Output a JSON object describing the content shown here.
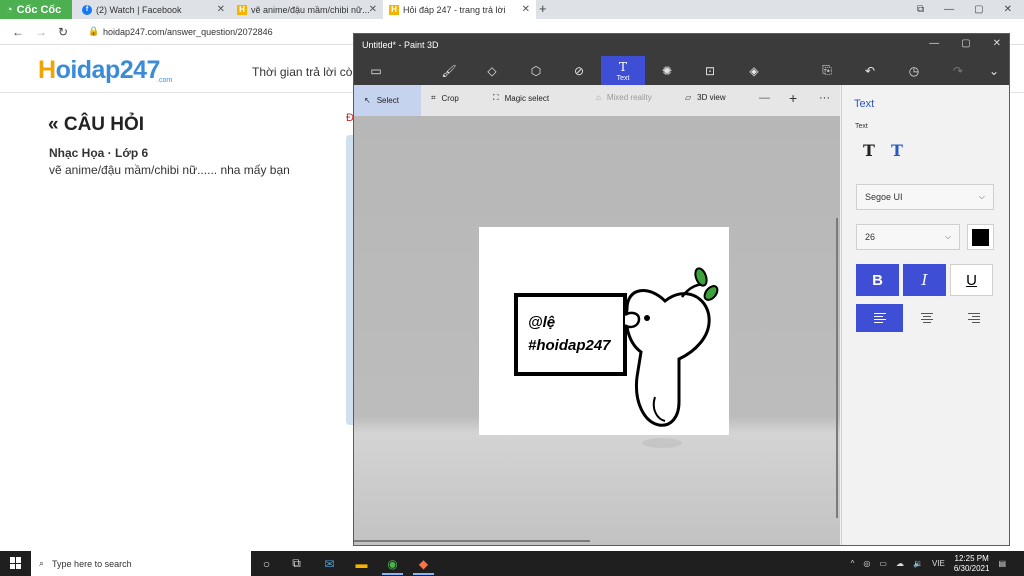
{
  "browser": {
    "brand_label": "Cốc Cốc",
    "tabs": [
      {
        "label": "(2) Watch | Facebook",
        "icon": "facebook-icon"
      },
      {
        "label": "vẽ anime/đậu mầm/chibi nữ...",
        "icon": "hoidap-icon"
      },
      {
        "label": "Hỏi đáp 247 - trang trả lời",
        "icon": "hoidap-icon"
      }
    ],
    "new_tab": "+",
    "url": "hoidap247.com/answer_question/2072846"
  },
  "site": {
    "logo_main": "oidap247",
    "logo_h": "H",
    "logo_sub": ".com",
    "header_text": "Thời gian trả lời cò",
    "question_heading": "CÂU HỎI",
    "question_meta": "Nhạc Họa · Lớp 6",
    "question_body": "vẽ anime/đậu mầm/chibi nữ...... nha mấy bạn",
    "red_mark": "Đ"
  },
  "paint3d": {
    "title": "Untitled* - Paint 3D",
    "toolbar": [
      {
        "name": "menu-icon",
        "glyph": "▭",
        "label": ""
      },
      {
        "name": "brushes-icon",
        "glyph": "🖌",
        "label": ""
      },
      {
        "name": "2d-shapes-icon",
        "glyph": "◇",
        "label": ""
      },
      {
        "name": "3d-shapes-icon",
        "glyph": "⬡",
        "label": ""
      },
      {
        "name": "stickers-icon",
        "glyph": "⊘",
        "label": ""
      },
      {
        "name": "text-icon",
        "glyph": "T",
        "label": "Text"
      },
      {
        "name": "effects-icon",
        "glyph": "✺",
        "label": ""
      },
      {
        "name": "canvas-icon",
        "glyph": "⊡",
        "label": ""
      },
      {
        "name": "3d-library-icon",
        "glyph": "◈",
        "label": ""
      }
    ],
    "sub_tools": {
      "select": "Select",
      "crop": "Crop",
      "magic_select": "Magic select",
      "mixed_reality": "Mixed reality",
      "view_3d": "3D view",
      "zoom_out": "—",
      "zoom_in": "+",
      "more": "···"
    },
    "canvas_text_line1": "@lệ",
    "canvas_text_line2": "#hoidap247",
    "panel": {
      "title": "Text",
      "subtitle": "Text",
      "font": "Segoe UI",
      "size": "26",
      "bold": "B",
      "italic": "I",
      "underline": "U",
      "color": "#000000"
    }
  },
  "taskbar": {
    "search_placeholder": "Type here to search",
    "lang": "VIE",
    "time": "12:25 PM",
    "date": "6/30/2021"
  }
}
